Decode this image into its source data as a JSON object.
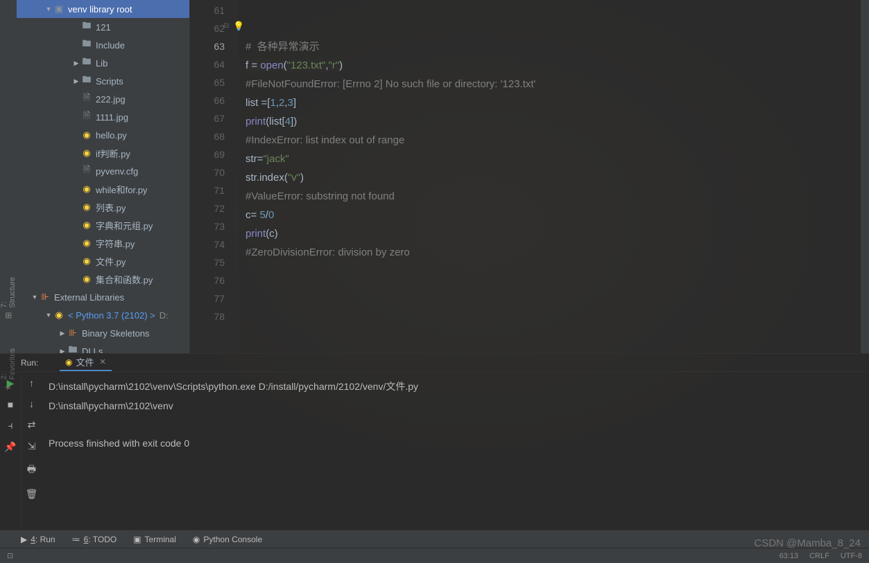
{
  "tree": {
    "root": "venv library root",
    "items": [
      {
        "label": "121",
        "indent": 80,
        "icon": "folder",
        "arrow": ""
      },
      {
        "label": "Include",
        "indent": 80,
        "icon": "folder",
        "arrow": ""
      },
      {
        "label": "Lib",
        "indent": 80,
        "icon": "folder",
        "arrow": "▶"
      },
      {
        "label": "Scripts",
        "indent": 80,
        "icon": "folder",
        "arrow": "▶"
      },
      {
        "label": "222.jpg",
        "indent": 80,
        "icon": "file",
        "arrow": ""
      },
      {
        "label": "1111.jpg",
        "indent": 80,
        "icon": "file",
        "arrow": ""
      },
      {
        "label": "hello.py",
        "indent": 80,
        "icon": "py",
        "arrow": ""
      },
      {
        "label": "if判断.py",
        "indent": 80,
        "icon": "py",
        "arrow": ""
      },
      {
        "label": "pyvenv.cfg",
        "indent": 80,
        "icon": "file",
        "arrow": ""
      },
      {
        "label": "while和for.py",
        "indent": 80,
        "icon": "py",
        "arrow": ""
      },
      {
        "label": "列表.py",
        "indent": 80,
        "icon": "py",
        "arrow": ""
      },
      {
        "label": "字典和元组.py",
        "indent": 80,
        "icon": "py",
        "arrow": ""
      },
      {
        "label": "字符串.py",
        "indent": 80,
        "icon": "py",
        "arrow": ""
      },
      {
        "label": "文件.py",
        "indent": 80,
        "icon": "py",
        "arrow": ""
      },
      {
        "label": "集合和函数.py",
        "indent": 80,
        "icon": "py",
        "arrow": ""
      }
    ],
    "external": "External Libraries",
    "python": "< Python 3.7 (2102) >",
    "python_suffix": "D:",
    "binary": "Binary Skeletons",
    "dlls": "DLLs"
  },
  "left_tabs": {
    "structure": "7: Structure",
    "favorites": "2: Favorites"
  },
  "editor": {
    "lines": [
      61,
      62,
      63,
      64,
      65,
      66,
      67,
      68,
      69,
      70,
      71,
      72,
      73,
      74,
      75,
      76,
      77,
      78
    ],
    "current_line": 63,
    "code": {
      "l62": "#  各种异常演示",
      "l63_a": "f = ",
      "l63_b": "open",
      "l63_c": "(",
      "l63_d": "\"123.txt\"",
      "l63_e": ",",
      "l63_f": "\"r\"",
      "l63_g": ")",
      "l64": "#FileNotFoundError: [Errno 2] No such file or directory: '123.txt'",
      "l65_a": "list =[",
      "l65_b": "1",
      "l65_c": ",",
      "l65_d": "2",
      "l65_e": ",",
      "l65_f": "3",
      "l65_g": "]",
      "l66_a": "print",
      "l66_b": "(list[",
      "l66_c": "4",
      "l66_d": "])",
      "l67": "#IndexError: list index out of range",
      "l68_a": "str=",
      "l68_b": "\"jack\"",
      "l69_a": "str.index(",
      "l69_b": "\"v\"",
      "l69_c": ")",
      "l70": "#ValueError: substring not found",
      "l71_a": "c= ",
      "l71_b": "5",
      "l71_c": "/",
      "l71_d": "0",
      "l72_a": "print",
      "l72_b": "(c)",
      "l73": "#ZeroDivisionError: division by zero"
    }
  },
  "run": {
    "label": "Run:",
    "tab": "文件",
    "output_l1": "D:\\install\\pycharm\\2102\\venv\\Scripts\\python.exe D:/install/pycharm/2102/venv/文件.py",
    "output_l2": "D:\\install\\pycharm\\2102\\venv",
    "output_l3": "Process finished with exit code 0"
  },
  "bottom": {
    "run": "4: Run",
    "todo": "6: TODO",
    "terminal": "Terminal",
    "python_console": "Python Console"
  },
  "status": {
    "pos": "63:13",
    "crlf": "CRLF",
    "encoding": "UTF-8"
  },
  "watermark": "CSDN @Mamba_8_24"
}
